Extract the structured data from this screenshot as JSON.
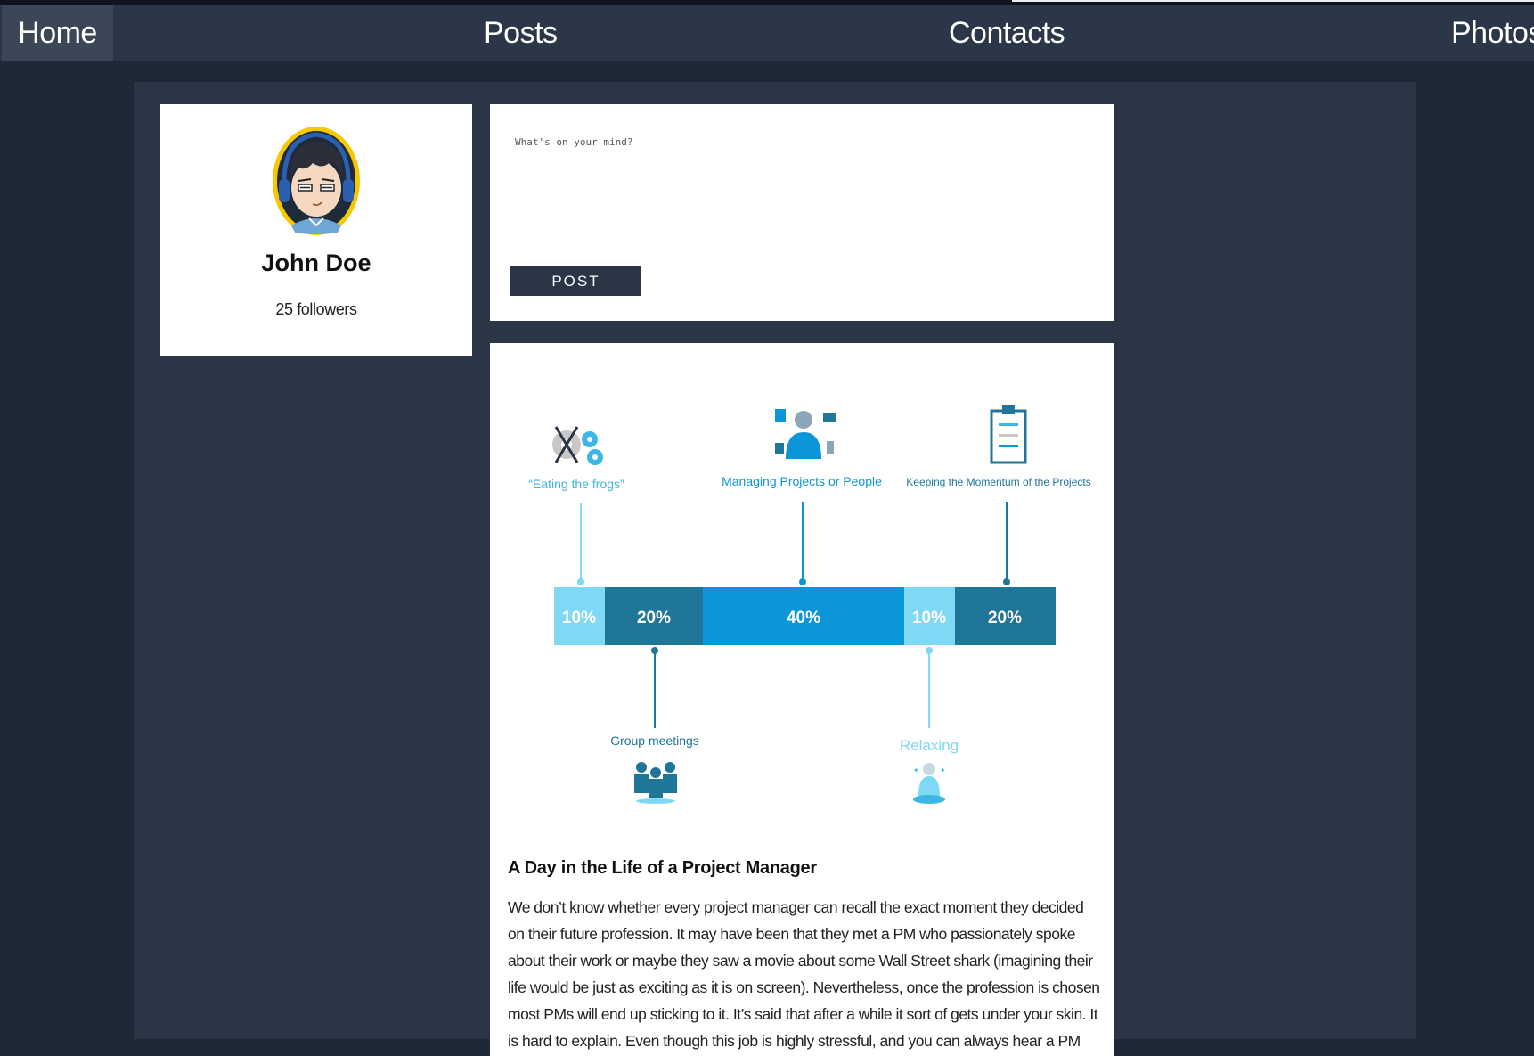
{
  "nav": {
    "items": [
      {
        "label": "Home",
        "active": true
      },
      {
        "label": "Posts"
      },
      {
        "label": "Contacts"
      },
      {
        "label": "Photos"
      }
    ]
  },
  "profile": {
    "name": "John Doe",
    "followers": "25 followers",
    "avatar_icon": "avatar-headphones-icon"
  },
  "composer": {
    "placeholder": "What's on your mind?",
    "post_label": "POST"
  },
  "post": {
    "infographic": {
      "segments": [
        {
          "value": "10%",
          "color": "#7fd8f4",
          "text_color": "#ffffff"
        },
        {
          "value": "20%",
          "color": "#1f7699",
          "text_color": "#ffffff"
        },
        {
          "value": "40%",
          "color": "#0a96d8",
          "text_color": "#ffffff"
        },
        {
          "value": "10%",
          "color": "#7fd8f4",
          "text_color": "#ffffff"
        },
        {
          "value": "20%",
          "color": "#1f7699",
          "text_color": "#ffffff"
        }
      ],
      "labels": [
        {
          "text": "“Eating the frogs”",
          "icon": "gears-icon"
        },
        {
          "text": "Managing Projects or People",
          "icon": "manager-icon"
        },
        {
          "text": "Keeping the Momentum of the Projects",
          "icon": "clipboard-icon"
        },
        {
          "text": "Group meetings",
          "icon": "group-icon"
        },
        {
          "text": "Relaxing",
          "icon": "meditation-icon"
        }
      ]
    },
    "title": "A Day in the Life of a Project Manager",
    "body": "We don’t know whether every project manager can recall the exact moment they decided on their future profession. It may have been that they met a PM who passionately spoke about their work or maybe they saw a movie about some Wall Street shark (imagining their life would be just as exciting as it is on screen). Nevertheless, once the profession is chosen most PMs will end up sticking to it. It’s said that after a while it sort of gets under your skin. It is hard to explain. Even though this job is highly stressful, and you can always hear a PM wining and swearing “when this"
  }
}
